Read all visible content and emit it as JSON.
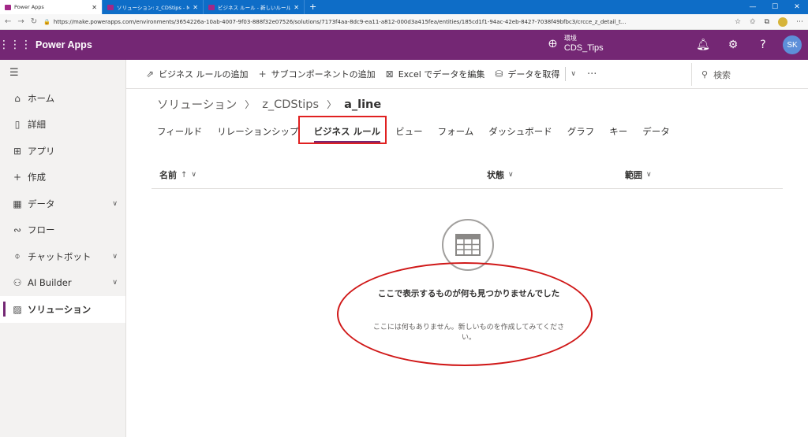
{
  "browser": {
    "tabs": [
      {
        "label": "Power Apps",
        "active": true
      },
      {
        "label": "ソリューション: z_CDStips - Microso",
        "active": false
      },
      {
        "label": "ビジネス ルール - 新しいルール - Micr",
        "active": false
      }
    ],
    "tab_close": "✕",
    "new_tab": "+",
    "url": "https://make.powerapps.com/environments/3654226a-10ab-4007-9f03-888f32e07526/solutions/7173f4aa-8dc9-ea11-a812-000d3a415fea/entities/185cd1f1-94ac-42eb-8427-7038f49bfbc3/crcce_z_detail_t...",
    "window_controls": [
      "—",
      "☐",
      "✕"
    ],
    "nav_icons": [
      "back-icon",
      "forward-icon",
      "refresh-icon"
    ]
  },
  "app": {
    "name": "Power Apps",
    "environment_label": "環境",
    "environment_name": "CDS_Tips",
    "user_initials": "SK",
    "brand_color": "#742774"
  },
  "left_nav": {
    "items": [
      {
        "label": "ホーム",
        "icon": "home-icon",
        "has_chevron": false,
        "selected": false
      },
      {
        "label": "詳細",
        "icon": "book-icon",
        "has_chevron": false,
        "selected": false
      },
      {
        "label": "アプリ",
        "icon": "apps-icon",
        "has_chevron": false,
        "selected": false
      },
      {
        "label": "作成",
        "icon": "plus-icon",
        "has_chevron": false,
        "selected": false
      },
      {
        "label": "データ",
        "icon": "table-icon",
        "has_chevron": true,
        "selected": false
      },
      {
        "label": "フロー",
        "icon": "flow-icon",
        "has_chevron": false,
        "selected": false
      },
      {
        "label": "チャットボット",
        "icon": "chatbot-icon",
        "has_chevron": true,
        "selected": false
      },
      {
        "label": "AI Builder",
        "icon": "ai-builder-icon",
        "has_chevron": true,
        "selected": false
      },
      {
        "label": "ソリューション",
        "icon": "solution-icon",
        "has_chevron": false,
        "selected": true
      }
    ]
  },
  "command_bar": {
    "add_business_rule": "ビジネス ルールの追加",
    "add_subcomponent": "サブコンポーネントの追加",
    "edit_in_excel": "Excel でデータを編集",
    "get_data": "データを取得",
    "more": "···",
    "search_placeholder": "検索"
  },
  "breadcrumb": {
    "root": "ソリューション",
    "solution": "z_CDStips",
    "entity": "a_line"
  },
  "tabs": [
    {
      "label": "フィールド",
      "active": false
    },
    {
      "label": "リレーションシップ",
      "active": false
    },
    {
      "label": "ビジネス ルール",
      "active": true
    },
    {
      "label": "ビュー",
      "active": false
    },
    {
      "label": "フォーム",
      "active": false
    },
    {
      "label": "ダッシュボード",
      "active": false
    },
    {
      "label": "グラフ",
      "active": false
    },
    {
      "label": "キー",
      "active": false
    },
    {
      "label": "データ",
      "active": false
    }
  ],
  "table": {
    "columns": [
      {
        "label": "名前",
        "sort": "↑"
      },
      {
        "label": "状態",
        "sort": ""
      },
      {
        "label": "範囲",
        "sort": ""
      }
    ]
  },
  "empty_state": {
    "title": "ここで表示するものが何も見つかりませんでした",
    "subtitle": "ここには何もありません。新しいものを作成してみてください。"
  },
  "annotations": {
    "highlight_color": "#e02020"
  }
}
